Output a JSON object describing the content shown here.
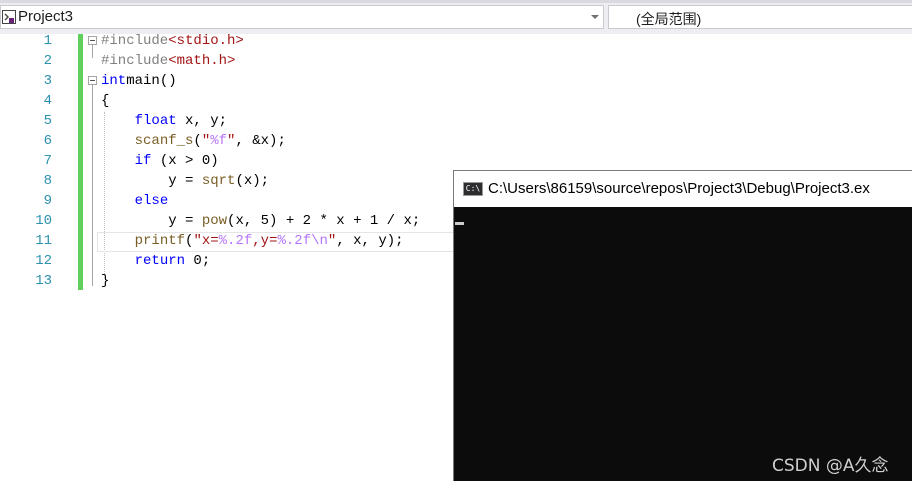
{
  "toolbar": {
    "project": "Project3",
    "scope": "(全局范围)"
  },
  "editor": {
    "line_numbers": [
      "1",
      "2",
      "3",
      "4",
      "5",
      "6",
      "7",
      "8",
      "9",
      "10",
      "11",
      "12",
      "13"
    ]
  },
  "console": {
    "title": "C:\\Users\\86159\\source\\repos\\Project3\\Debug\\Project3.ex",
    "icon_text": "C:\\"
  },
  "watermark": "CSDN @A久念",
  "colors": {
    "keyword": "#0000ff",
    "preprocessor": "#808080",
    "string": "#a31515",
    "format_specifier": "#b776fb",
    "line_number": "#2b91af",
    "change_bar": "#60cf5b",
    "console_bg": "#0c0c0c"
  },
  "code_lines": [
    {
      "ind": "",
      "seg": [
        [
          "pp",
          "#include"
        ],
        [
          "inc",
          "<stdio.h>"
        ]
      ]
    },
    {
      "ind": "",
      "seg": [
        [
          "pp",
          "#include"
        ],
        [
          "inc",
          "<math.h>"
        ]
      ]
    },
    {
      "ind": "",
      "seg": [
        [
          "kw",
          "int"
        ],
        [
          "",
          "main()"
        ]
      ]
    },
    {
      "ind": "",
      "seg": [
        [
          "",
          "{"
        ]
      ]
    },
    {
      "ind": "    ",
      "seg": [
        [
          "kw",
          "float"
        ],
        [
          "",
          " x, y;"
        ]
      ]
    },
    {
      "ind": "    ",
      "seg": [
        [
          "fn",
          "scanf_s"
        ],
        [
          "",
          "("
        ],
        [
          "str",
          "\""
        ],
        [
          "fmt",
          "%f"
        ],
        [
          "str",
          "\""
        ],
        [
          "",
          ", &x);"
        ]
      ]
    },
    {
      "ind": "    ",
      "seg": [
        [
          "kw",
          "if"
        ],
        [
          "",
          " (x > 0)"
        ]
      ]
    },
    {
      "ind": "        ",
      "seg": [
        [
          "",
          "y = "
        ],
        [
          "fn",
          "sqrt"
        ],
        [
          "",
          "(x);"
        ]
      ]
    },
    {
      "ind": "    ",
      "seg": [
        [
          "kw",
          "else"
        ]
      ]
    },
    {
      "ind": "        ",
      "seg": [
        [
          "",
          "y = "
        ],
        [
          "fn",
          "pow"
        ],
        [
          "",
          "(x, 5) + 2 * x + 1 / x;"
        ]
      ]
    },
    {
      "ind": "    ",
      "seg": [
        [
          "fn",
          "printf"
        ],
        [
          "",
          "("
        ],
        [
          "str",
          "\"x="
        ],
        [
          "fmt",
          "%.2f"
        ],
        [
          "str",
          ",y="
        ],
        [
          "fmt",
          "%.2f"
        ],
        [
          "esc",
          "\\n"
        ],
        [
          "str",
          "\""
        ],
        [
          "",
          ", x, y);"
        ]
      ]
    },
    {
      "ind": "    ",
      "seg": [
        [
          "kw",
          "return"
        ],
        [
          "",
          " 0;"
        ]
      ]
    },
    {
      "ind": "",
      "seg": [
        [
          "",
          "}"
        ]
      ]
    }
  ]
}
